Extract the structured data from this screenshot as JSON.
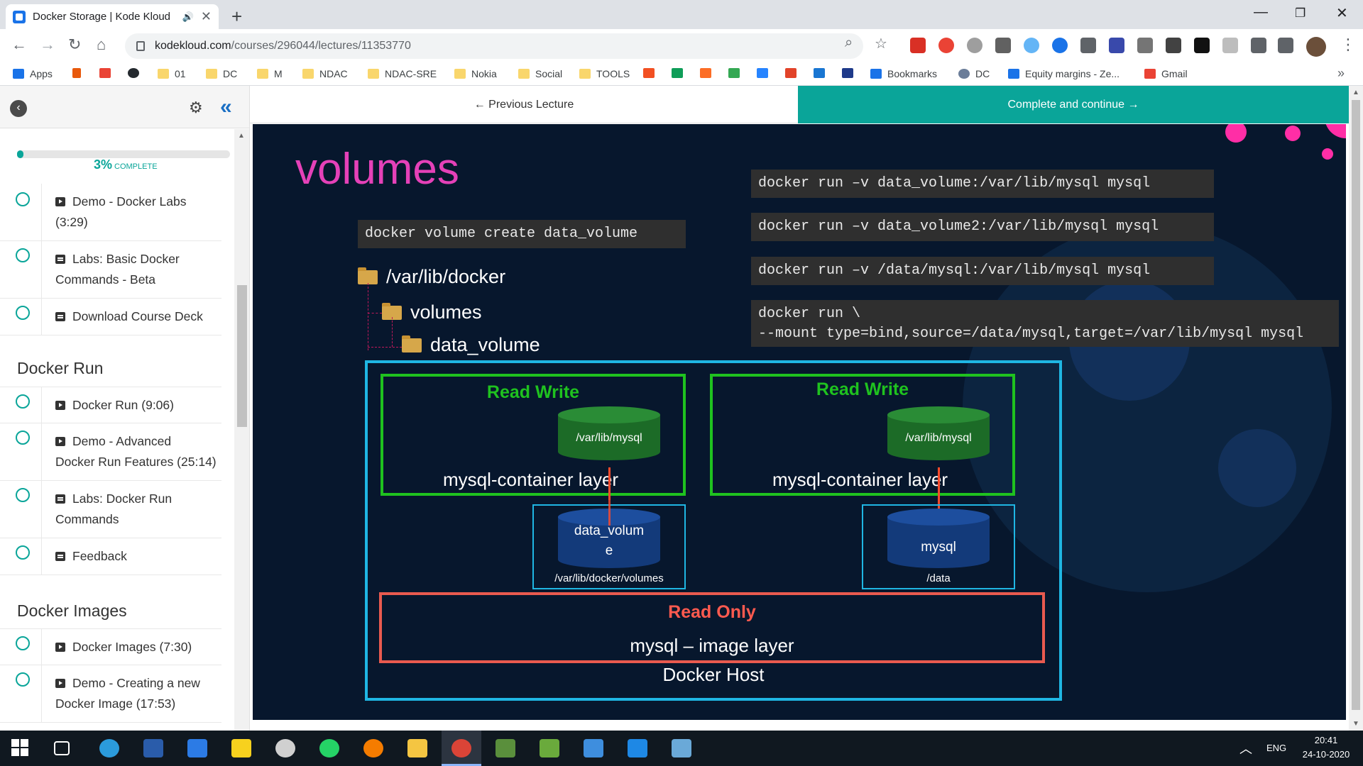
{
  "browser": {
    "tab_title": "Docker Storage | Kode Kloud",
    "tab_audio_icon": "speaker-icon",
    "tab_close": "✕",
    "new_tab": "+",
    "window_min": "—",
    "window_restore": "❐",
    "window_close": "✕",
    "url_host": "kodekloud.com",
    "url_path": "/courses/296044/lectures/11353770"
  },
  "bookmarks": [
    {
      "label": "Apps",
      "icon": "apps-grid-icon"
    },
    {
      "label": "",
      "icon": "fire-icon"
    },
    {
      "label": "",
      "icon": "gmail-icon"
    },
    {
      "label": "",
      "icon": "github-icon"
    },
    {
      "label": "01",
      "icon": "folder-icon"
    },
    {
      "label": "DC",
      "icon": "folder-icon"
    },
    {
      "label": "M",
      "icon": "folder-icon"
    },
    {
      "label": "NDAC",
      "icon": "folder-icon"
    },
    {
      "label": "NDAC-SRE",
      "icon": "folder-icon"
    },
    {
      "label": "Nokia",
      "icon": "folder-icon"
    },
    {
      "label": "Social",
      "icon": "folder-icon"
    },
    {
      "label": "TOOLS",
      "icon": "folder-icon"
    },
    {
      "label": "Bookmarks",
      "icon": "star-icon"
    },
    {
      "label": "DC",
      "icon": "globe-icon"
    },
    {
      "label": "Equity margins - Ze...",
      "icon": "bookmark-icon"
    },
    {
      "label": "Gmail",
      "icon": "gmail-icon"
    }
  ],
  "bookmarks_more": "»",
  "sidebar": {
    "back_icon": "‹",
    "gear_icon": "⚙",
    "collapse_icon": "«",
    "progress_percent": 3,
    "progress_label": "3%",
    "progress_suffix": "COMPLETE",
    "lectures_top": [
      {
        "line1": "Demo - Docker Labs",
        "line2": "(3:29)",
        "kind": "video"
      },
      {
        "line1": "Labs: Basic Docker",
        "line2": "Commands - Beta",
        "kind": "doc"
      },
      {
        "line1": "Download Course Deck",
        "line2": "",
        "kind": "doc"
      }
    ],
    "section_run": "Docker Run",
    "lectures_run": [
      {
        "line1": "Docker Run (9:06)",
        "line2": "",
        "kind": "video"
      },
      {
        "line1": "Demo - Advanced",
        "line2": "Docker Run Features (25:14)",
        "kind": "video"
      },
      {
        "line1": "Labs: Docker Run",
        "line2": "Commands",
        "kind": "doc"
      },
      {
        "line1": "Feedback",
        "line2": "",
        "kind": "doc"
      }
    ],
    "section_images": "Docker Images",
    "lectures_images": [
      {
        "line1": "Docker Images (7:30)",
        "line2": "",
        "kind": "video"
      },
      {
        "line1": "Demo - Creating a new",
        "line2": "Docker Image (17:53)",
        "kind": "video"
      }
    ]
  },
  "nav": {
    "previous": "← Previous Lecture",
    "next": "Complete and continue →"
  },
  "slide": {
    "title": "volumes",
    "cmd_create": "docker volume create data_volume",
    "cmd_run1": "docker run –v data_volume:/var/lib/mysql mysql",
    "cmd_run2": "docker run –v data_volume2:/var/lib/mysql mysql",
    "cmd_run3": "docker run –v /data/mysql:/var/lib/mysql mysql",
    "cmd_mount_line1": "docker run \\",
    "cmd_mount_line2": "--mount type=bind,source=/data/mysql,target=/var/lib/mysql mysql",
    "tree_root": "/var/lib/docker",
    "tree_child": "volumes",
    "tree_grandchild": "data_volume",
    "rw_label": "Read Write",
    "cyl_mount": "/var/lib/mysql",
    "layer_label": "mysql-container layer",
    "cyl_volume_l1": "data_volum",
    "cyl_volume_l2": "e",
    "volume_caption_left": "/var/lib/docker/volumes",
    "cyl_mysql": "mysql",
    "volume_caption_right": "/data",
    "ro_label": "Read Only",
    "ro_sub": "mysql – image layer",
    "host_label": "Docker Host"
  },
  "taskbar": {
    "lang": "ENG",
    "time": "20:41",
    "date": "24-10-2020",
    "tray_chevron": "︿"
  },
  "colors": {
    "accent": "#0aa599",
    "slide_bg": "#07172d",
    "title_pink": "#e541b8",
    "rw_green": "#1fc21f",
    "host_blue": "#1fb6e3",
    "ro_red": "#ff5a4f"
  }
}
